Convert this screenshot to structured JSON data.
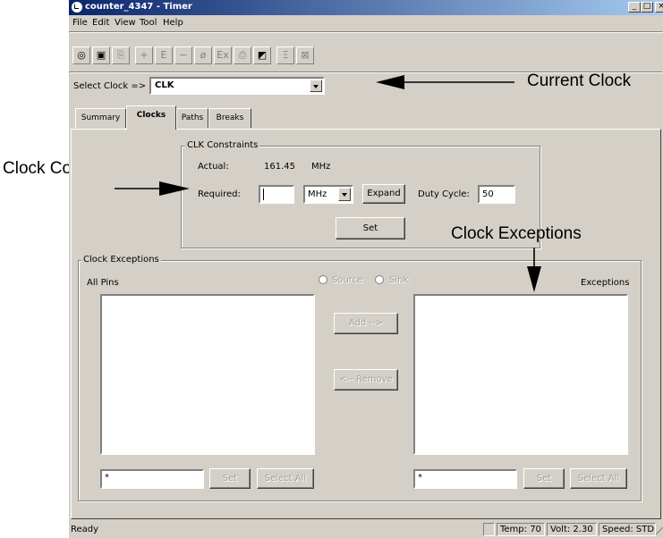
{
  "window": {
    "title": "counter_4347 - Timer"
  },
  "menu": [
    "File",
    "Edit",
    "View",
    "Tool",
    "Help"
  ],
  "toolbar_icons": [
    "open-icon",
    "save-icon",
    "copy-icon",
    "plus-icon",
    "e-icon",
    "minus-icon",
    "phi-icon",
    "ex-icon",
    "print-icon",
    "chart-icon",
    "calc-icon",
    "report-icon"
  ],
  "toolbar_glyphs": [
    "◎",
    "▣",
    "⎘",
    "+",
    "E",
    "−",
    "ø",
    "Ex",
    "⎙",
    "◩",
    "Ξ",
    "⊠"
  ],
  "clock_select": {
    "label": "Select Clock =>",
    "value": "CLK"
  },
  "tabs": [
    "Summary",
    "Clocks",
    "Paths",
    "Breaks"
  ],
  "constraints": {
    "group_label": "CLK Constraints",
    "actual_label": "Actual:",
    "actual_value": "161.45",
    "actual_unit": "MHz",
    "required_label": "Required:",
    "required_value": "",
    "unit_value": "MHz",
    "expand_label": "Expand",
    "duty_label": "Duty Cycle:",
    "duty_value": "50",
    "set_label": "Set"
  },
  "exceptions": {
    "group_label": "Clock Exceptions",
    "all_pins_label": "All Pins",
    "source_label": "Source",
    "sink_label": "Sink",
    "exceptions_label": "Exceptions",
    "add_label": "Add -->",
    "remove_label": "<-- Remove",
    "left_filter": "*",
    "right_filter": "*",
    "set_label": "Set",
    "select_all_label": "Select All"
  },
  "status": {
    "ready": "Ready",
    "temp": "Temp: 70",
    "volt": "Volt: 2.30",
    "speed": "Speed: STD"
  },
  "annotations": {
    "current_clock": "Current Clock",
    "clock_constraints": "Clock Constraints",
    "clock_exceptions": "Clock Exceptions"
  }
}
